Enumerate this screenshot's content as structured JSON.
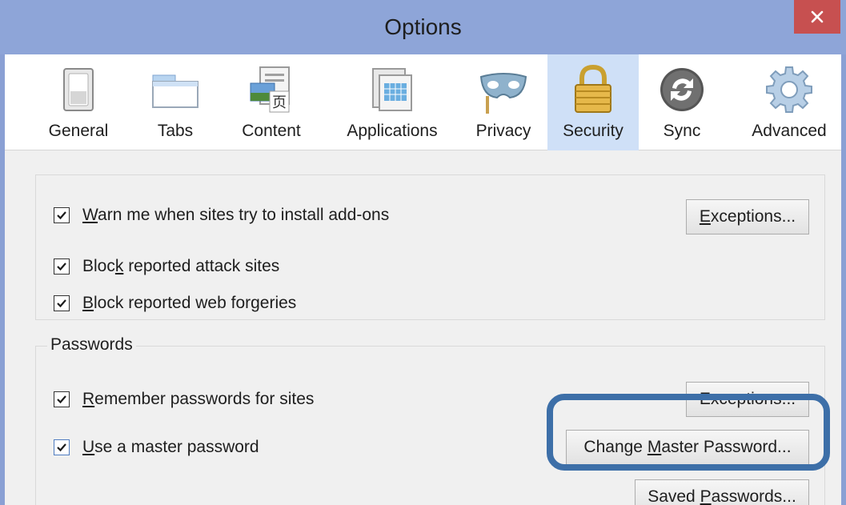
{
  "window": {
    "title": "Options"
  },
  "toolbar": {
    "items": [
      {
        "label": "General",
        "icon": "switch-icon",
        "selected": false
      },
      {
        "label": "Tabs",
        "icon": "tabs-icon",
        "selected": false
      },
      {
        "label": "Content",
        "icon": "content-icon",
        "selected": false
      },
      {
        "label": "Applications",
        "icon": "applications-icon",
        "selected": false
      },
      {
        "label": "Privacy",
        "icon": "mask-icon",
        "selected": false
      },
      {
        "label": "Security",
        "icon": "padlock-icon",
        "selected": true
      },
      {
        "label": "Sync",
        "icon": "sync-icon",
        "selected": false
      },
      {
        "label": "Advanced",
        "icon": "gear-icon",
        "selected": false
      }
    ]
  },
  "security": {
    "warn_addons": {
      "pre": "",
      "u": "W",
      "post": "arn me when sites try to install add-ons",
      "checked": true
    },
    "addons_exceptions": {
      "pre": "",
      "u": "E",
      "post": "xceptions..."
    },
    "block_attack": {
      "pre": "Bloc",
      "u": "k",
      "post": " reported attack sites",
      "checked": true
    },
    "block_forgeries": {
      "pre": "",
      "u": "B",
      "post": "lock reported web forgeries",
      "checked": true
    }
  },
  "passwords": {
    "legend": "Passwords",
    "remember": {
      "pre": "",
      "u": "R",
      "post": "emember passwords for sites",
      "checked": true
    },
    "remember_exceptions": {
      "pre": "Exceptions",
      "u": "",
      "post": "..."
    },
    "master": {
      "pre": "",
      "u": "U",
      "post": "se a master password",
      "checked": true
    },
    "change_master": {
      "pre": "Change ",
      "u": "M",
      "post": "aster Password..."
    },
    "saved": {
      "pre": "Saved ",
      "u": "P",
      "post": "asswords..."
    }
  },
  "colors": {
    "titlebar": "#8ea5d8",
    "close": "#c75050",
    "selected_tab": "#cfe0f7",
    "highlight": "#3d6fa8"
  }
}
